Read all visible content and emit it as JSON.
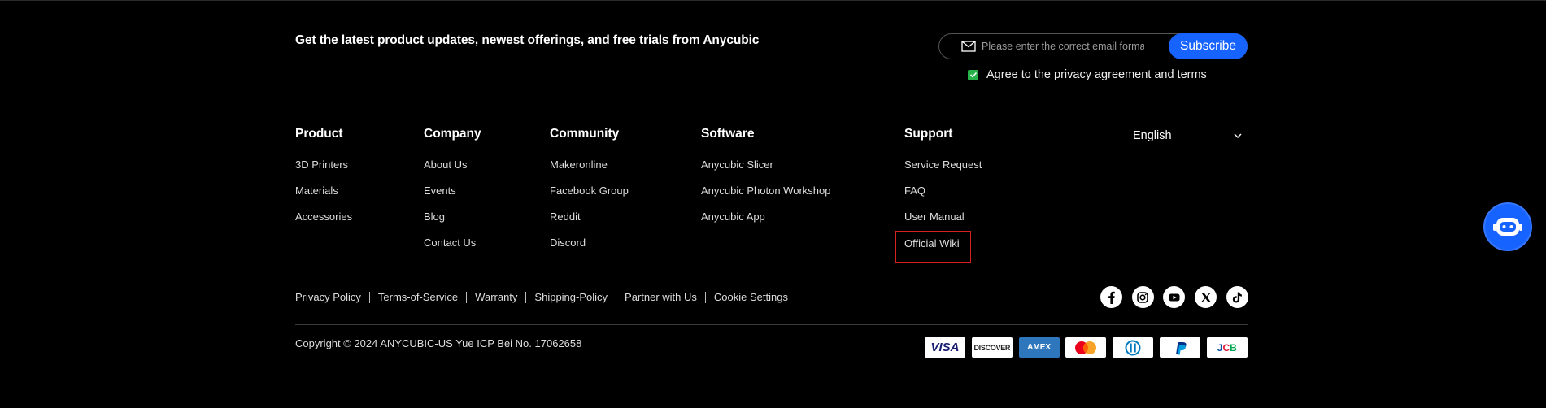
{
  "newsletter": {
    "title": "Get the latest product updates, newest offerings, and free trials from Anycubic",
    "email_placeholder": "Please enter the correct email format",
    "subscribe_label": "Subscribe",
    "agree_text": "Agree to the privacy agreement and terms",
    "agree_checked": true
  },
  "columns": {
    "product": {
      "title": "Product",
      "links": [
        "3D Printers",
        "Materials",
        "Accessories"
      ]
    },
    "company": {
      "title": "Company",
      "links": [
        "About Us",
        "Events",
        "Blog",
        "Contact Us"
      ]
    },
    "community": {
      "title": "Community",
      "links": [
        "Makeronline",
        "Facebook Group",
        "Reddit",
        "Discord"
      ]
    },
    "software": {
      "title": "Software",
      "links": [
        "Anycubic Slicer",
        "Anycubic Photon Workshop",
        "Anycubic App"
      ]
    },
    "support": {
      "title": "Support",
      "links": [
        "Service Request",
        "FAQ",
        "User Manual",
        "Official Wiki"
      ]
    }
  },
  "language": {
    "selected": "English"
  },
  "policy_links": [
    "Privacy Policy",
    "Terms-of-Service",
    "Warranty",
    "Shipping-Policy",
    "Partner with Us",
    "Cookie Settings"
  ],
  "socials": [
    "facebook-icon",
    "instagram-icon",
    "youtube-icon",
    "x-icon",
    "tiktok-icon"
  ],
  "copyright": "Copyright © 2024 ANYCUBIC-US Yue ICP Bei No. 17062658",
  "payments": {
    "visa": "VISA",
    "discover": "DISCOVER",
    "amex": "AMEX",
    "jcb": "JCB"
  },
  "colors": {
    "accent": "#1763ff",
    "checkbox": "#27b34a",
    "highlight": "#d61f1f",
    "background": "#000000"
  }
}
